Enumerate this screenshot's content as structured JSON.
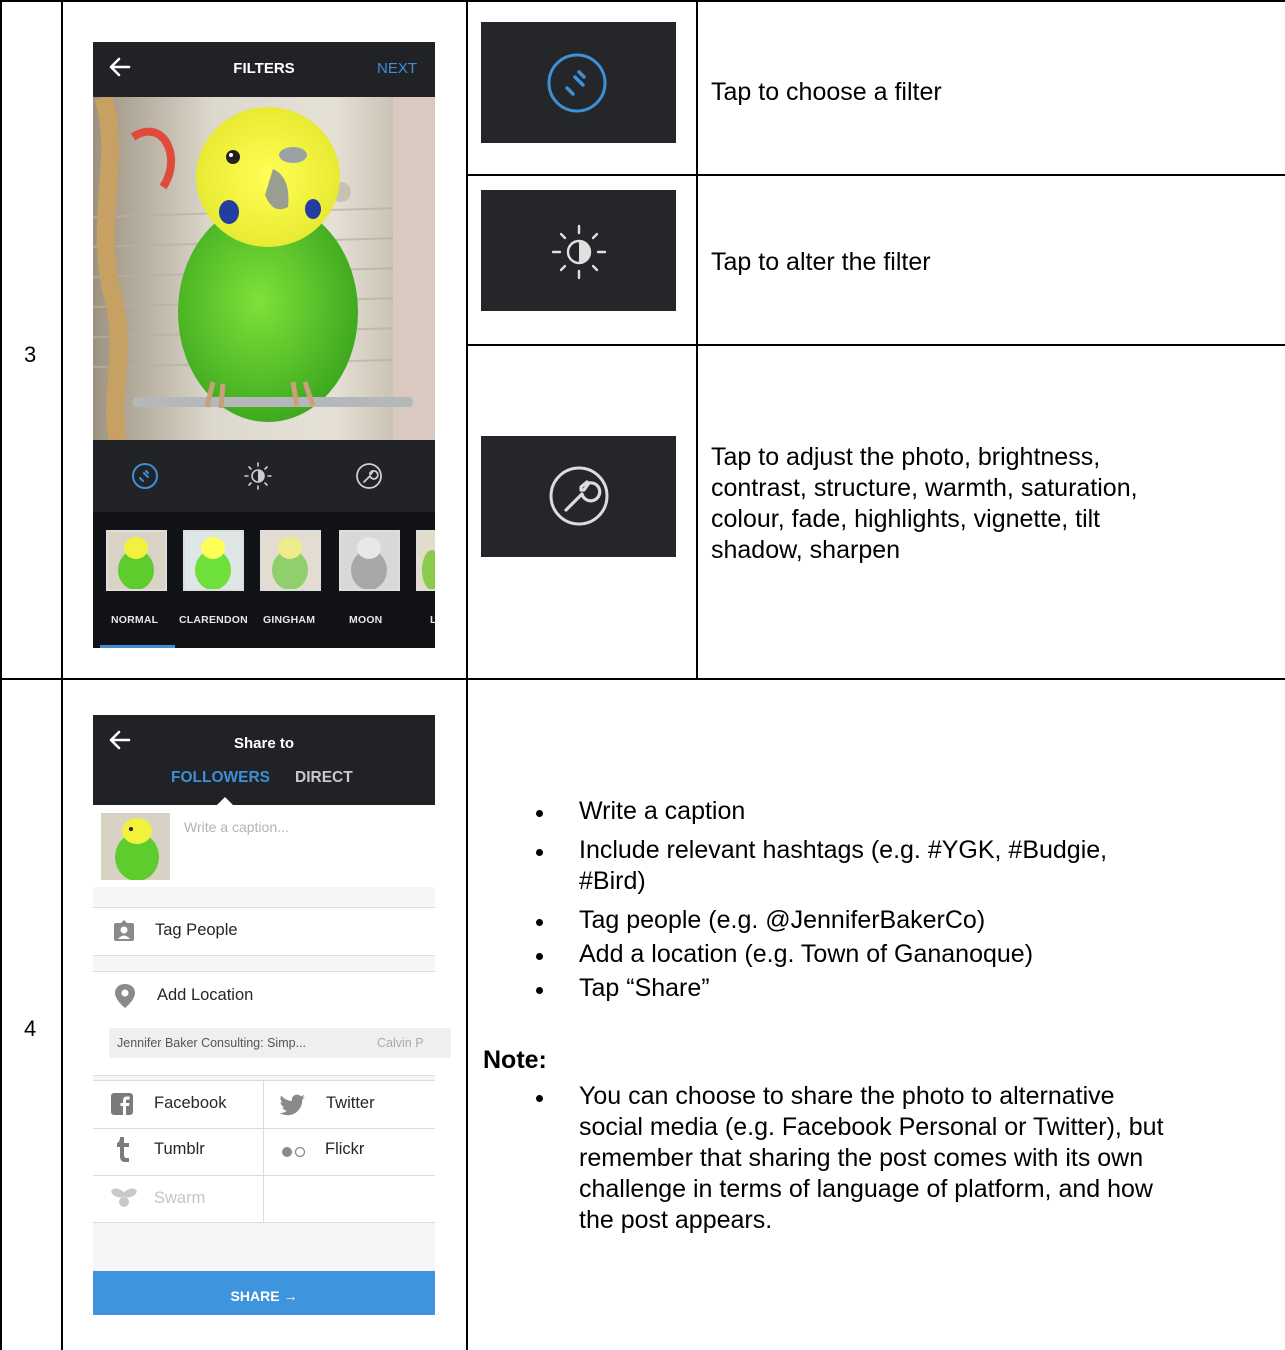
{
  "steps": [
    {
      "number": "3"
    },
    {
      "number": "4"
    }
  ],
  "filters_screen": {
    "title": "FILTERS",
    "next_label": "NEXT",
    "filter_names": [
      "NORMAL",
      "CLARENDON",
      "GINGHAM",
      "MOON",
      "L"
    ]
  },
  "tool_instructions": [
    {
      "icon": "filter-icon",
      "text": "Tap to choose a filter"
    },
    {
      "icon": "brightness-icon",
      "text": "Tap to alter the filter"
    },
    {
      "icon": "wrench-icon",
      "lines": [
        "Tap to adjust the photo, brightness,",
        "contrast, structure, warmth, saturation,",
        "colour, fade, highlights, vignette, tilt",
        "shadow, sharpen"
      ]
    }
  ],
  "share_screen": {
    "title": "Share to",
    "tabs": [
      "FOLLOWERS",
      "DIRECT"
    ],
    "caption_placeholder": "Write a caption...",
    "tag_people": "Tag People",
    "add_location": "Add Location",
    "location_chips": [
      "Jennifer Baker Consulting: Simp...",
      "Calvin P"
    ],
    "networks": [
      "Facebook",
      "Twitter",
      "Tumblr",
      "Flickr",
      "Swarm"
    ],
    "share_label": "SHARE →"
  },
  "share_instructions": {
    "bullets": [
      [
        "Write a caption"
      ],
      [
        "Include relevant hashtags (e.g. #YGK, #Budgie,",
        "#Bird)"
      ],
      [
        "Tag people (e.g. @JenniferBakerCo)"
      ],
      [
        "Add a location (e.g. Town of Gananoque)"
      ],
      [
        "Tap “Share”"
      ]
    ],
    "note_heading": "Note:",
    "note_lines": [
      "You can choose to share the photo to alternative",
      "social media (e.g. Facebook Personal or Twitter), but",
      "remember that sharing the post comes with its own",
      "challenge in terms of language of platform, and how",
      "the post appears."
    ]
  },
  "colors": {
    "accent": "#3d8fd6",
    "dark_panel": "#25262a"
  }
}
